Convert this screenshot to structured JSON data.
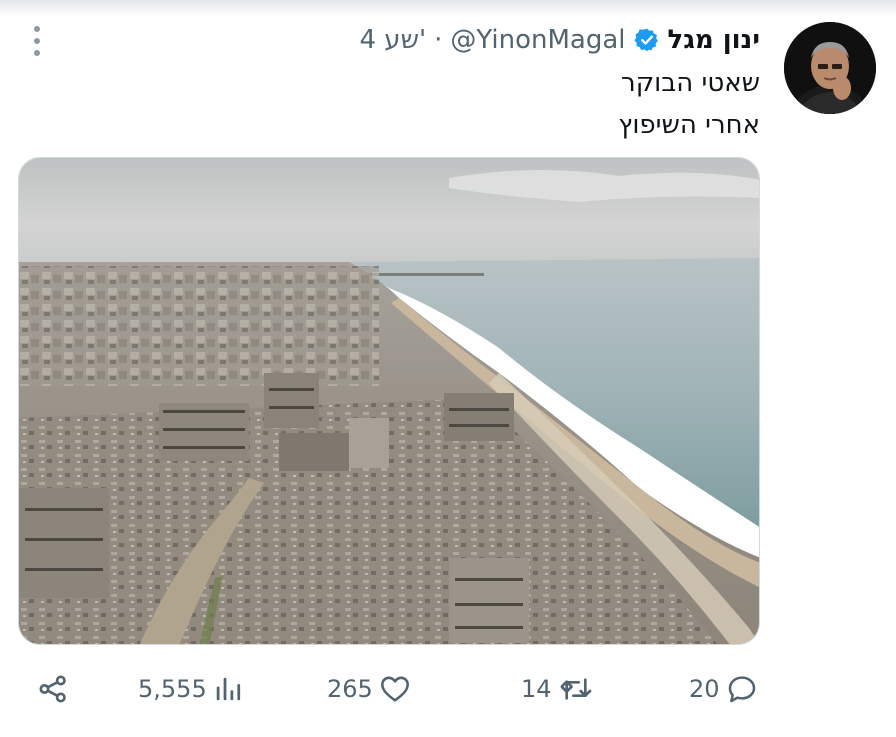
{
  "tweet": {
    "author_name": "ינון מגל",
    "handle": "@YinonMagal",
    "separator": "·",
    "time": "4 שע'",
    "lines": [
      "שאטי הבוקר",
      "אחרי השיפוץ"
    ]
  },
  "actions": {
    "share_icon": "share-icon",
    "views": "5,555",
    "likes": "265",
    "retweets": "14",
    "replies": "20"
  },
  "colors": {
    "verified": "#1d9bf0",
    "muted": "#536471",
    "text": "#0f1419"
  }
}
